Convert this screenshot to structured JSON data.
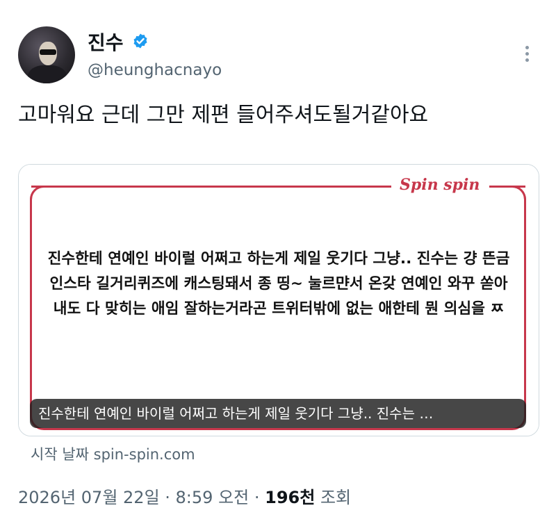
{
  "author": {
    "display_name": "진수",
    "handle": "@heunghacnayo",
    "avatar_icon": "user-avatar",
    "verified_icon": "verified-badge-icon",
    "verified_color": "#1d9bf0"
  },
  "tweet": {
    "text": "고마워요 근데 그만 제편 들어주셔도될거같아요"
  },
  "card": {
    "logo_text": "Spin spin",
    "brand_color": "#c7374b",
    "body_text": "진수한테 연예인 바이럴 어쩌고 하는게 제일 웃기다 그냥.. 진수는 걍 뜬금 인스타 길거리퀴즈에 캐스팅돼서 종 띵~ 눌르먄서 온갖 연예인 와꾸 쏟아내도 다 맞히는 애임 잘하는거라곤 트위터밖에 없는 애한테 뭔 의심을 ㅉ",
    "caption": "진수한테 연예인 바이럴 어쩌고 하는게 제일 웃기다 그냥.. 진수는 …",
    "source": "시작 날짜 spin-spin.com"
  },
  "meta": {
    "timestamp": "2026년 07월 22일 · 8:59 오전 · ",
    "views_count": "196천",
    "views_label": " 조회"
  },
  "more_icon": "more-options-icon"
}
